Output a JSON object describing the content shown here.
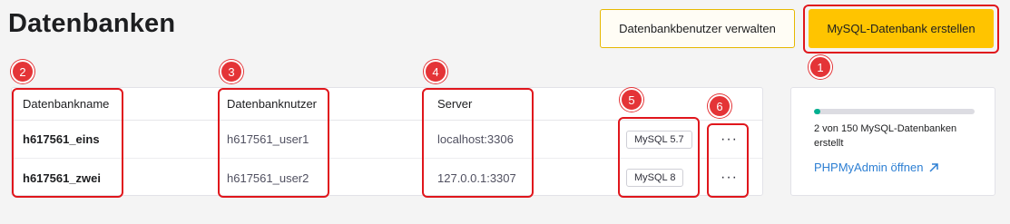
{
  "page": {
    "title": "Datenbanken"
  },
  "buttons": {
    "manage_users": "Datenbankbenutzer verwalten",
    "create_db": "MySQL-Datenbank erstellen"
  },
  "table": {
    "columns": [
      "Datenbankname",
      "Datenbanknutzer",
      "Server"
    ],
    "rows": [
      {
        "name": "h617561_eins",
        "user": "h617561_user1",
        "server": "localhost:3306",
        "version": "MySQL 5.7",
        "more": "···"
      },
      {
        "name": "h617561_zwei",
        "user": "h617561_user2",
        "server": "127.0.0.1:3307",
        "version": "MySQL 8",
        "more": "···"
      }
    ]
  },
  "usage": {
    "text": "2 von 150 MySQL-Datenbanken erstellt",
    "used": 2,
    "total": 150,
    "link": "PHPMyAdmin öffnen"
  },
  "markers": [
    "1",
    "2",
    "3",
    "4",
    "5",
    "6"
  ],
  "colors": {
    "accent": "#ffc400",
    "highlight": "#e0161c",
    "progress": "#00b090",
    "link": "#2d7fd3"
  },
  "icons": {
    "more": "more-icon",
    "link": "external-link-icon"
  }
}
